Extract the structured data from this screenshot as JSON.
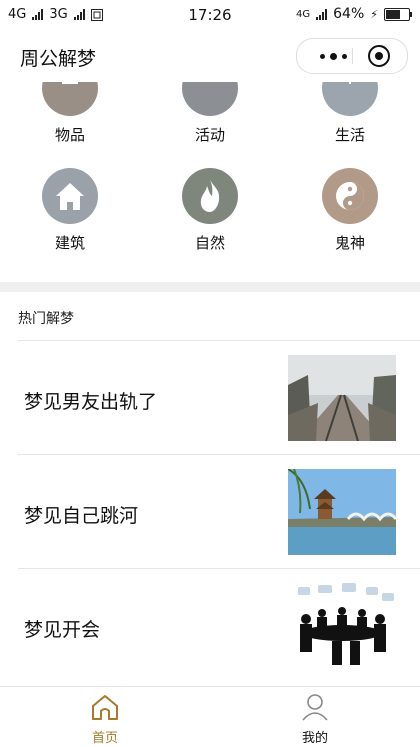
{
  "status": {
    "left_carrier_1": "4G",
    "left_carrier_2": "3G",
    "time": "17:26",
    "right_network": "4G",
    "battery": "64%",
    "battery_level": 0.64
  },
  "nav": {
    "title": "周公解梦"
  },
  "categories": [
    {
      "label": "物品",
      "icon": "object-icon"
    },
    {
      "label": "活动",
      "icon": "bicycle-icon"
    },
    {
      "label": "生活",
      "icon": "umbrella-icon"
    },
    {
      "label": "建筑",
      "icon": "house-icon"
    },
    {
      "label": "自然",
      "icon": "fire-icon"
    },
    {
      "label": "鬼神",
      "icon": "yin-yang-icon"
    }
  ],
  "hot": {
    "title": "热门解梦",
    "items": [
      {
        "title": "梦见男友出轨了",
        "image": "railroad-tracks-photo"
      },
      {
        "title": "梦见自己跳河",
        "image": "pagoda-bridge-river-photo"
      },
      {
        "title": "梦见开会",
        "image": "meeting-silhouette-photo"
      }
    ]
  },
  "tabbar": {
    "home": "首页",
    "mine": "我的",
    "active_color": "#a57a2a"
  }
}
